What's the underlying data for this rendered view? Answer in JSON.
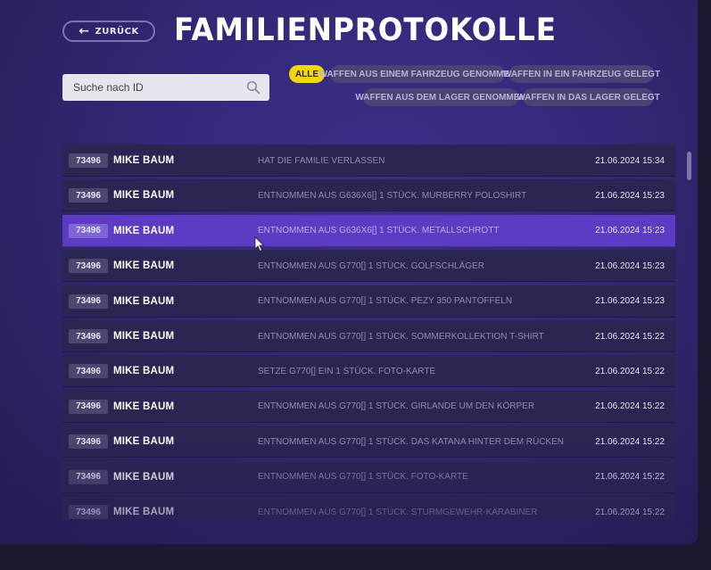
{
  "header": {
    "back_label": "ZURÜCK",
    "title": "FAMILIENPROTOKOLLE"
  },
  "search": {
    "placeholder": "Suche nach ID",
    "value": ""
  },
  "filters": [
    {
      "label": "ALLE",
      "active": true
    },
    {
      "label": "WAFFEN AUS EINEM FAHRZEUG GENOMMEN",
      "active": false
    },
    {
      "label": "WAFFEN IN EIN FAHRZEUG GELEGT",
      "active": false
    },
    {
      "label": "WAFFEN AUS DEM LAGER GENOMMEN",
      "active": false
    },
    {
      "label": "WAFFEN IN DAS LAGER GELEGT",
      "active": false
    }
  ],
  "log": [
    {
      "id": "73496",
      "name": "MIKE BAUM",
      "action": "HAT DIE FAMILIE VERLASSEN",
      "date": "21.06.2024 15:34",
      "selected": false
    },
    {
      "id": "73496",
      "name": "MIKE BAUM",
      "action": "ENTNOMMEN AUS G636X6[] 1 STÜCK. MURBERRY POLOSHIRT",
      "date": "21.06.2024 15:23",
      "selected": false
    },
    {
      "id": "73496",
      "name": "MIKE BAUM",
      "action": "ENTNOMMEN AUS G636X6[] 1 STÜCK. METALLSCHROTT",
      "date": "21.06.2024 15:23",
      "selected": true
    },
    {
      "id": "73496",
      "name": "MIKE BAUM",
      "action": "ENTNOMMEN AUS G770[] 1 STÜCK. GOLFSCHLÄGER",
      "date": "21.06.2024 15:23",
      "selected": false
    },
    {
      "id": "73496",
      "name": "MIKE BAUM",
      "action": "ENTNOMMEN AUS G770[] 1 STÜCK. PEZY 350 PANTOFFELN",
      "date": "21.06.2024 15:23",
      "selected": false
    },
    {
      "id": "73496",
      "name": "MIKE BAUM",
      "action": "ENTNOMMEN AUS G770[] 1 STÜCK. SOMMERKOLLEKTION T-SHIRT",
      "date": "21.06.2024 15:22",
      "selected": false
    },
    {
      "id": "73496",
      "name": "MIKE BAUM",
      "action": "SETZE G770[] EIN 1 STÜCK. FOTO-KARTE",
      "date": "21.06.2024 15:22",
      "selected": false
    },
    {
      "id": "73496",
      "name": "MIKE BAUM",
      "action": "ENTNOMMEN AUS G770[] 1 STÜCK. GIRLANDE UM DEN KÖRPER",
      "date": "21.06.2024 15:22",
      "selected": false
    },
    {
      "id": "73496",
      "name": "MIKE BAUM",
      "action": "ENTNOMMEN AUS G770[] 1 STÜCK. DAS KATANA HINTER DEM RÜCKEN",
      "date": "21.06.2024 15:22",
      "selected": false
    },
    {
      "id": "73496",
      "name": "MIKE BAUM",
      "action": "ENTNOMMEN AUS G770[] 1 STÜCK. FOTO-KARTE",
      "date": "21.06.2024 15:22",
      "selected": false
    },
    {
      "id": "73496",
      "name": "MIKE BAUM",
      "action": "ENTNOMMEN AUS G770[] 1 STÜCK. STURMGEWEHR-KARABINER",
      "date": "21.06.2024 15:22",
      "selected": false
    }
  ],
  "colors": {
    "accent": "#f4d60f",
    "selected_row": "#5e3bc4",
    "row": "#2b2551"
  }
}
